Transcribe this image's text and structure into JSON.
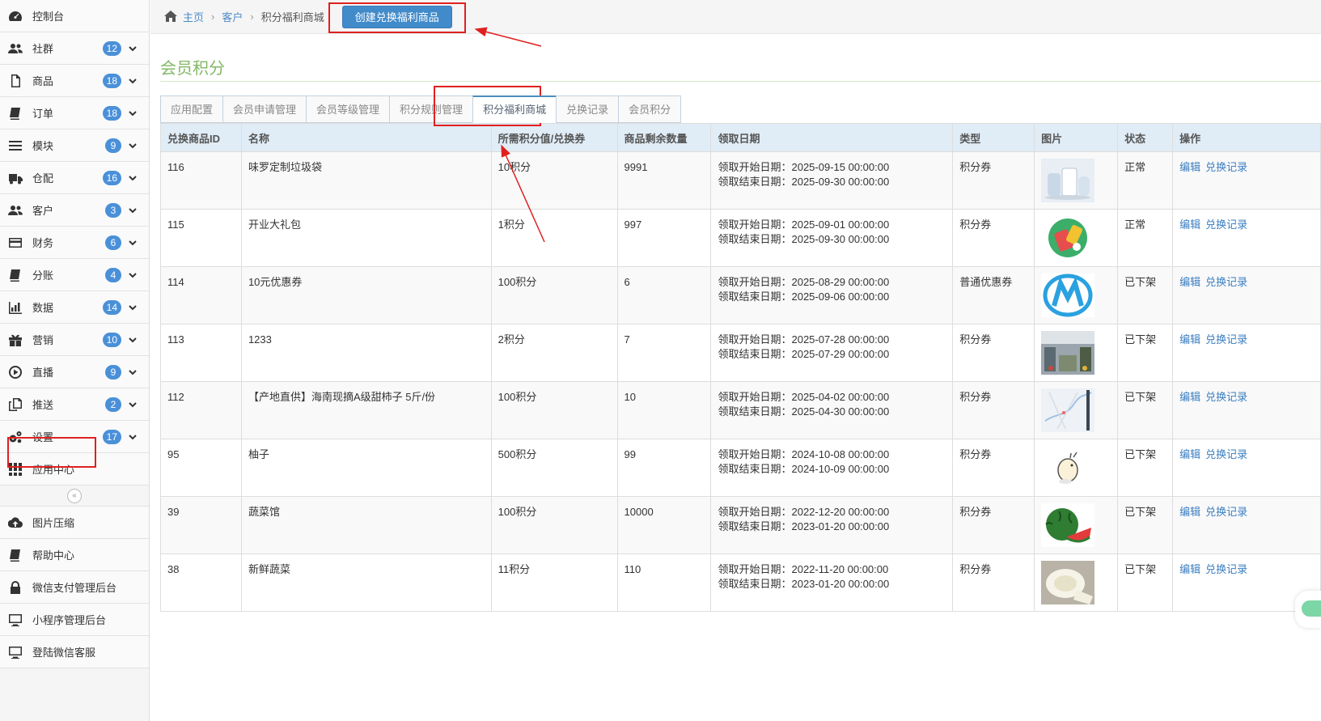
{
  "sidebar": {
    "items": [
      {
        "label": "控制台",
        "icon": "dashboard-icon"
      },
      {
        "label": "社群",
        "badge": "12",
        "icon": "users-icon"
      },
      {
        "label": "商品",
        "badge": "18",
        "icon": "file-icon"
      },
      {
        "label": "订单",
        "badge": "18",
        "icon": "book-icon"
      },
      {
        "label": "模块",
        "badge": "9",
        "icon": "list-icon"
      },
      {
        "label": "仓配",
        "badge": "16",
        "icon": "truck-icon"
      },
      {
        "label": "客户",
        "badge": "3",
        "icon": "users-icon"
      },
      {
        "label": "财务",
        "badge": "6",
        "icon": "credit-card-icon"
      },
      {
        "label": "分账",
        "badge": "4",
        "icon": "book-icon"
      },
      {
        "label": "数据",
        "badge": "14",
        "icon": "bar-chart-icon"
      },
      {
        "label": "营销",
        "badge": "10",
        "icon": "gift-icon"
      },
      {
        "label": "直播",
        "badge": "9",
        "icon": "play-circle-icon"
      },
      {
        "label": "推送",
        "badge": "2",
        "icon": "copy-icon"
      },
      {
        "label": "设置",
        "badge": "17",
        "icon": "cogs-icon"
      },
      {
        "label": "应用中心",
        "icon": "grid-icon"
      }
    ],
    "extra_items": [
      {
        "label": "图片压缩",
        "icon": "cloud-upload-icon"
      },
      {
        "label": "帮助中心",
        "icon": "book-icon"
      },
      {
        "label": "微信支付管理后台",
        "icon": "lock-icon"
      },
      {
        "label": "小程序管理后台",
        "icon": "monitor-icon"
      },
      {
        "label": "登陆微信客服",
        "icon": "monitor-icon"
      }
    ],
    "collapse_glyph": "«"
  },
  "breadcrumb": {
    "home": "主页",
    "customer": "客户",
    "current": "积分福利商城"
  },
  "create_button": "创建兑换福利商品",
  "page_title": "会员积分",
  "tabs": [
    "应用配置",
    "会员申请管理",
    "会员等级管理",
    "积分规则管理",
    "积分福利商城",
    "兑换记录",
    "会员积分"
  ],
  "active_tab": 4,
  "table": {
    "headers": [
      "兑换商品ID",
      "名称",
      "所需积分值/兑换券",
      "商品剩余数量",
      "领取日期",
      "类型",
      "图片",
      "状态",
      "操作"
    ],
    "rows": [
      {
        "id": "116",
        "name": "味罗定制垃圾袋",
        "points": "10积分",
        "stock": "9991",
        "start": "领取开始日期：2025-09-15 00:00:00",
        "end": "领取结束日期：2025-09-30 00:00:00",
        "type": "积分券",
        "image": "trash-bags-thumb",
        "status": "正常"
      },
      {
        "id": "115",
        "name": "开业大礼包",
        "points": "1积分",
        "stock": "997",
        "start": "领取开始日期：2025-09-01 00:00:00",
        "end": "领取结束日期：2025-09-30 00:00:00",
        "type": "积分券",
        "image": "gift-pack-thumb",
        "status": "正常"
      },
      {
        "id": "114",
        "name": "10元优惠券",
        "points": "100积分",
        "stock": "6",
        "start": "领取开始日期：2025-08-29 00:00:00",
        "end": "领取结束日期：2025-09-06 00:00:00",
        "type": "普通优惠券",
        "image": "m-logo-thumb",
        "status": "已下架"
      },
      {
        "id": "113",
        "name": "1233",
        "points": "2积分",
        "stock": "7",
        "start": "领取开始日期：2025-07-28 00:00:00",
        "end": "领取结束日期：2025-07-29 00:00:00",
        "type": "积分券",
        "image": "store-photo-thumb",
        "status": "已下架"
      },
      {
        "id": "112",
        "name": "【产地直供】海南现摘A级甜柿子 5斤/份",
        "points": "100积分",
        "stock": "10",
        "start": "领取开始日期：2025-04-02 00:00:00",
        "end": "领取结束日期：2025-04-30 00:00:00",
        "type": "积分券",
        "image": "map-thumb",
        "status": "已下架"
      },
      {
        "id": "95",
        "name": "柚子",
        "points": "500积分",
        "stock": "99",
        "start": "领取开始日期：2024-10-08 00:00:00",
        "end": "领取结束日期：2024-10-09 00:00:00",
        "type": "积分券",
        "image": "cartoon-thumb",
        "status": "已下架"
      },
      {
        "id": "39",
        "name": "蔬菜馆",
        "points": "100积分",
        "stock": "10000",
        "start": "领取开始日期：2022-12-20 00:00:00",
        "end": "领取结束日期：2023-01-20 00:00:00",
        "type": "积分券",
        "image": "watermelon-thumb",
        "status": "已下架"
      },
      {
        "id": "38",
        "name": "新鲜蔬菜",
        "points": "11积分",
        "stock": "110",
        "start": "领取开始日期：2022-11-20 00:00:00",
        "end": "领取结束日期：2023-01-20 00:00:00",
        "type": "积分券",
        "image": "melon-thumb",
        "status": "已下架"
      }
    ],
    "op_edit": "编辑",
    "op_records": "兑换记录"
  },
  "colors": {
    "accent": "#428bca",
    "title_green": "#82b866",
    "header_bg": "#e0ecf6",
    "annotation_red": "#e02020",
    "badge_blue": "#4a90d9"
  }
}
